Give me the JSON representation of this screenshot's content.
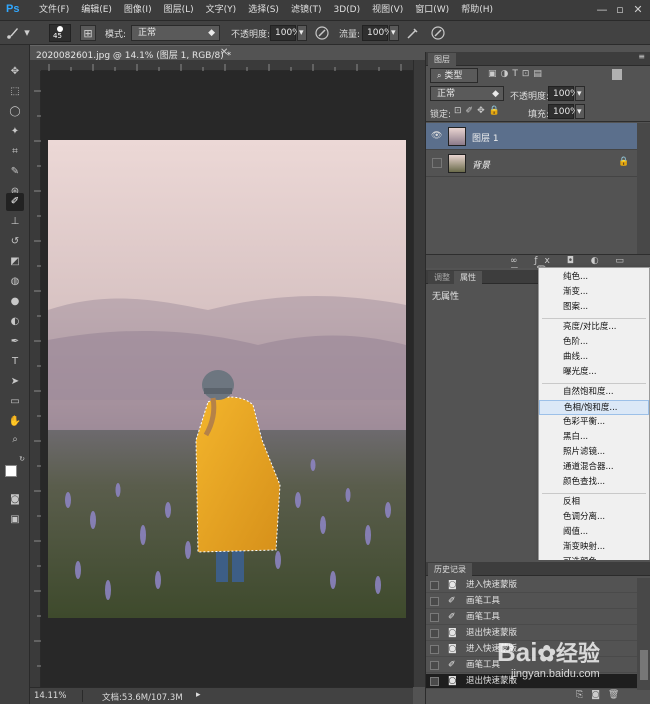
{
  "menubar": {
    "logo": "Ps",
    "items": [
      "文件(F)",
      "编辑(E)",
      "图像(I)",
      "图层(L)",
      "文字(Y)",
      "选择(S)",
      "滤镜(T)",
      "3D(D)",
      "视图(V)",
      "窗口(W)",
      "帮助(H)"
    ]
  },
  "options": {
    "brush_size": "45",
    "mode_label": "模式:",
    "mode_value": "正常",
    "opacity_label": "不透明度:",
    "opacity_value": "100%",
    "flow_label": "流量:",
    "flow_value": "100%"
  },
  "document": {
    "tab_title": "2020082601.jpg @ 14.1% (图层 1, RGB/8) *",
    "zoom": "14.11%",
    "doc_size": "文档:53.6M/107.3M"
  },
  "layers": {
    "tab": "图层",
    "filter_kind": "类型",
    "blend_mode": "正常",
    "opacity_label": "不透明度:",
    "opacity_value": "100%",
    "lock_label": "锁定:",
    "fill_label": "填充:",
    "fill_value": "100%",
    "items": [
      {
        "name": "图层 1"
      },
      {
        "name": "背景"
      }
    ]
  },
  "properties": {
    "tabs": [
      "调整",
      "属性"
    ],
    "empty_text": "无属性"
  },
  "adjust_menu": {
    "items": [
      "纯色...",
      "渐变...",
      "图案...",
      "亮度/对比度...",
      "色阶...",
      "曲线...",
      "曝光度...",
      "自然饱和度...",
      "色相/饱和度...",
      "色彩平衡...",
      "黑白...",
      "照片滤镜...",
      "通道混合器...",
      "颜色查找...",
      "反相",
      "色调分离...",
      "阈值...",
      "渐变映射...",
      "可选颜色..."
    ],
    "highlighted": "色相/饱和度..."
  },
  "history": {
    "tab": "历史记录",
    "items": [
      "进入快速蒙版",
      "画笔工具",
      "画笔工具",
      "退出快速蒙版",
      "进入快速蒙版",
      "画笔工具",
      "退出快速蒙版"
    ]
  },
  "watermark": {
    "brand": "Bai",
    "brand2": "经验",
    "url": "jingyan.baidu.com"
  },
  "colors": {
    "accent_arrow": "#e8262a",
    "selected_layer": "#5b6f8c",
    "ps_blue": "#31a8ff"
  }
}
